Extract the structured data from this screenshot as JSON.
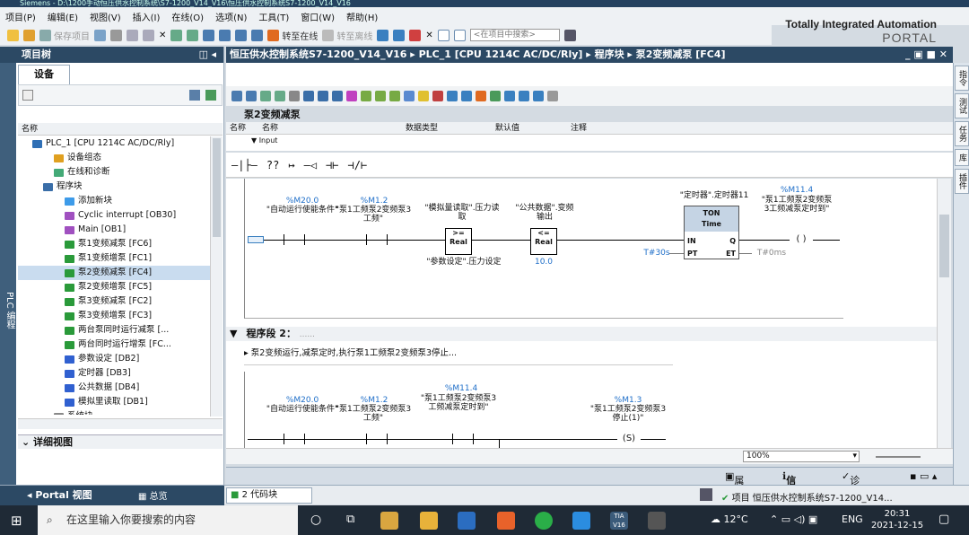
{
  "window": {
    "title": "Siemens - D:\\1200手动恒压供水控制系统\\S7-1200_V14_V16\\恒压供水控制系统S7-1200_V14_V16"
  },
  "menu": [
    "项目(P)",
    "编辑(E)",
    "视图(V)",
    "插入(I)",
    "在线(O)",
    "选项(N)",
    "工具(T)",
    "窗口(W)",
    "帮助(H)"
  ],
  "brand": {
    "line1": "Totally Integrated Automation",
    "line2": "PORTAL"
  },
  "toolbar": {
    "save_project": "保存项目",
    "go_online": "转至在线",
    "go_offline": "转至离线",
    "search_placeholder": "<在项目中搜索>"
  },
  "project_tree": {
    "title": "项目树",
    "vertical_label": "PLC 编程",
    "devices_tab": "设备",
    "column_name": "名称",
    "items": [
      {
        "label": "PLC_1 [CPU 1214C AC/DC/Rly]",
        "indent": 0,
        "color": "#2f6fb5"
      },
      {
        "label": "设备组态",
        "indent": 2,
        "color": "#e0a020"
      },
      {
        "label": "在线和诊断",
        "indent": 2,
        "color": "#4a7"
      },
      {
        "label": "程序块",
        "indent": 1,
        "color": "#3a6ea8"
      },
      {
        "label": "添加新块",
        "indent": 3,
        "color": "#3d9be9"
      },
      {
        "label": "Cyclic interrupt [OB30]",
        "indent": 3,
        "color": "#a050c0"
      },
      {
        "label": "Main [OB1]",
        "indent": 3,
        "color": "#a050c0"
      },
      {
        "label": "泵1变频减泵 [FC6]",
        "indent": 3,
        "color": "#2a9a3a"
      },
      {
        "label": "泵1变频增泵 [FC1]",
        "indent": 3,
        "color": "#2a9a3a"
      },
      {
        "label": "泵2变频减泵 [FC4]",
        "indent": 3,
        "color": "#2a9a3a",
        "selected": true
      },
      {
        "label": "泵2变频增泵 [FC5]",
        "indent": 3,
        "color": "#2a9a3a"
      },
      {
        "label": "泵3变频减泵 [FC2]",
        "indent": 3,
        "color": "#2a9a3a"
      },
      {
        "label": "泵3变频增泵 [FC3]",
        "indent": 3,
        "color": "#2a9a3a"
      },
      {
        "label": "两台泵同时运行减泵 [...",
        "indent": 3,
        "color": "#2a9a3a"
      },
      {
        "label": "两台同时运行增泵 [FC...",
        "indent": 3,
        "color": "#2a9a3a"
      },
      {
        "label": "参数设定 [DB2]",
        "indent": 3,
        "color": "#3060d0"
      },
      {
        "label": "定时器 [DB3]",
        "indent": 3,
        "color": "#3060d0"
      },
      {
        "label": "公共数据 [DB4]",
        "indent": 3,
        "color": "#3060d0"
      },
      {
        "label": "模拟里读取 [DB1]",
        "indent": 3,
        "color": "#3060d0"
      },
      {
        "label": "系统块",
        "indent": 2,
        "color": "#888"
      }
    ],
    "detail_view": "详细视图"
  },
  "editor": {
    "breadcrumb": "恒压供水控制系统S7-1200_V14_V16 ▸ PLC_1 [CPU 1214C AC/DC/Rly] ▸ 程序块 ▸ 泵2变频减泵 [FC4]",
    "block_name": "泵2变频减泵",
    "interface_cols": {
      "name": "名称",
      "type": "数据类型",
      "default": "默认值",
      "comment": "注释"
    },
    "interface_row": "▼ Input",
    "lad_symbols": [
      "—|├—",
      "??",
      "↦",
      "—◁",
      "⊣⊢",
      "⊣/⊢"
    ],
    "network1": {
      "c1_addr": "%M20.0",
      "c1_name": "\"自动运行使能条件\"",
      "c2_addr": "%M1.2",
      "c2_name": "\"泵1工频泵2变频泵3工频\"",
      "cmp1_top": "\"模拟量读取\".压力读取",
      "cmp1_op": ">=",
      "cmp1_type": "Real",
      "cmp1_bottom": "\"参数设定\".压力设定",
      "cmp2_top": "\"公共数据\".变频输出",
      "cmp2_op": "<=",
      "cmp2_type": "Real",
      "cmp2_bottom": "10.0",
      "timer_instance": "\"定时器\".定时器11",
      "timer_type": "TON",
      "timer_unit": "Time",
      "pt_value": "T#30s",
      "et_value": "T#0ms",
      "pin_in": "IN",
      "pin_pt": "PT",
      "pin_q": "Q",
      "pin_et": "ET",
      "coil_addr": "%M11.4",
      "coil_name": "\"泵1工频泵2变频泵3工频减泵定时到\"",
      "coil_symbol": "( )"
    },
    "network2": {
      "title": "程序段 2：",
      "title_hint": "......",
      "comment": "▸ 泵2变频运行,减泵定时,执行泵1工频泵2变频泵3停止...",
      "c1_addr": "%M20.0",
      "c1_name": "\"自动运行使能条件\"",
      "c2_addr": "%M1.2",
      "c2_name": "\"泵1工频泵2变频泵3工频\"",
      "c3_addr": "%M11.4",
      "c3_name": "\"泵1工频泵2变频泵3工频减泵定时到\"",
      "coil_addr": "%M1.3",
      "coil_name": "\"泵1工频泵2变频泵3停止(1)\"",
      "coil_symbol": "(S)"
    },
    "zoom": "100%"
  },
  "right_tabs": [
    "指令",
    "测试",
    "任务",
    "库",
    "插件"
  ],
  "props_tabs": {
    "properties": "属性",
    "info": "信息",
    "diagnostics": "诊断"
  },
  "portal_bar": {
    "portal_view": "Portal 视图",
    "overview": "总览",
    "code_block": "2 代码块",
    "status": "项目 恒压供水控制系统S7-1200_V14..."
  },
  "taskbar": {
    "search": "在这里输入你要搜索的内容",
    "weather": "12°C",
    "ime": "ENG",
    "time": "20:31",
    "date": "2021-12-15"
  }
}
